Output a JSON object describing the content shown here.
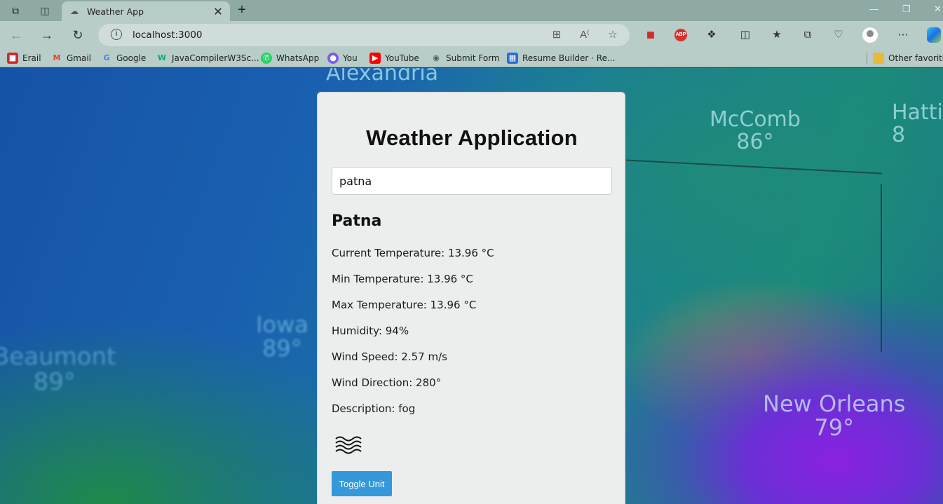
{
  "browser": {
    "tab_title": "Weather App",
    "url": "localhost:3000",
    "bookmarks": [
      {
        "label": "Erail",
        "icon": "erail-icon",
        "color": "#d12b2b"
      },
      {
        "label": "Gmail",
        "icon": "gmail-icon",
        "color": "#ea4335"
      },
      {
        "label": "Google",
        "icon": "google-icon",
        "color": "#4285f4"
      },
      {
        "label": "JavaCompilerW3Sc...",
        "icon": "w3schools-icon",
        "color": "#04aa6d"
      },
      {
        "label": "WhatsApp",
        "icon": "whatsapp-icon",
        "color": "#25d366"
      },
      {
        "label": "You",
        "icon": "you-icon",
        "color": "#7b5cf0"
      },
      {
        "label": "YouTube",
        "icon": "youtube-icon",
        "color": "#ff0000"
      },
      {
        "label": "Submit Form",
        "icon": "form-icon",
        "color": "#555555"
      },
      {
        "label": "Resume Builder · Re...",
        "icon": "resume-icon",
        "color": "#2b6cd6"
      }
    ],
    "other_favorites": "Other favorites"
  },
  "map_labels": [
    {
      "text": "Alexandria"
    },
    {
      "text": "McComb\n86°"
    },
    {
      "text": "Hatti\n8"
    },
    {
      "text": "Iowa\n89°"
    },
    {
      "text": "Beaumont\n89°"
    },
    {
      "text": "New Orleans\n79°"
    }
  ],
  "app": {
    "title": "Weather Application",
    "search_value": "patna",
    "city": "Patna",
    "current_temp": "Current Temperature: 13.96 °C",
    "min_temp": "Min Temperature: 13.96 °C",
    "max_temp": "Max Temperature: 13.96 °C",
    "humidity": "Humidity: 94%",
    "wind_speed": "Wind Speed: 2.57 m/s",
    "wind_direction": "Wind Direction: 280°",
    "description": "Description: fog",
    "weather_icon": "fog-icon",
    "toggle_label": "Toggle Unit",
    "accent_color": "#3498db"
  }
}
